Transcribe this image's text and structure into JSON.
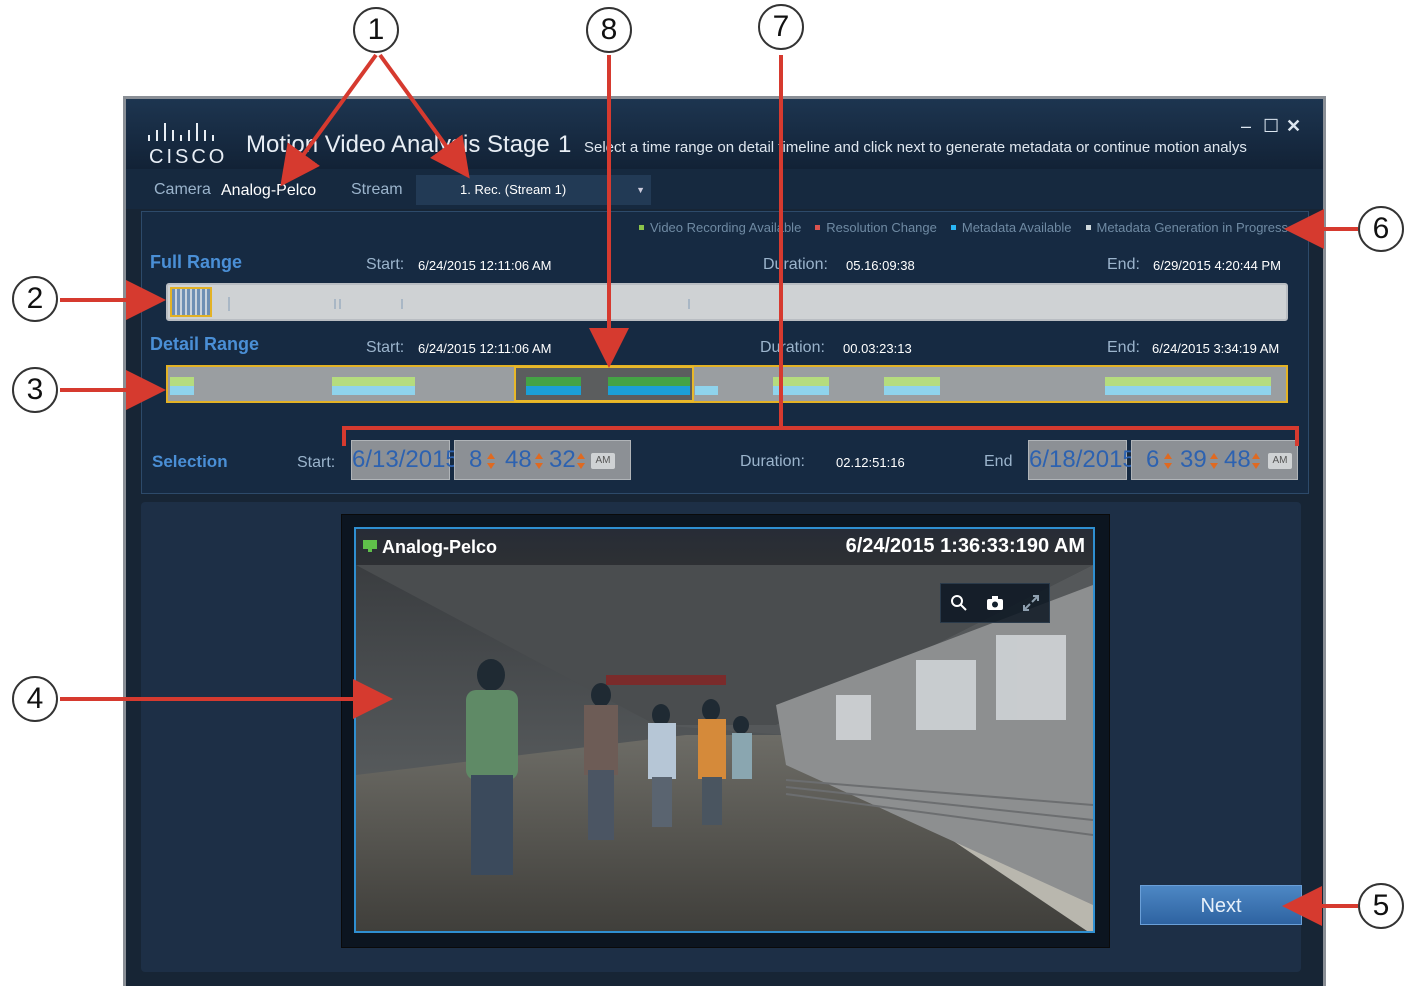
{
  "window": {
    "logo_text": "CISCO",
    "title": "Motion Video Analysis Stage",
    "stage": "1",
    "instructions": "Select a time range on detail timeline and click next to generate metadata or continue motion analys",
    "minimize": "‒",
    "maximize": "☐",
    "close": "✕"
  },
  "camera": {
    "label": "Camera",
    "value": "Analog-Pelco",
    "stream_label": "Stream",
    "stream_number": "1.",
    "stream_value": "Rec. (Stream 1)",
    "stream_caret": "▼"
  },
  "legend": [
    {
      "label": "Video Recording Available",
      "color": "#8bc34a"
    },
    {
      "label": "Resolution Change",
      "color": "#d9534f"
    },
    {
      "label": "Metadata Available",
      "color": "#29b6f6"
    },
    {
      "label": "Metadata Generation in Progress",
      "color": "#cfd8dc"
    }
  ],
  "full_range": {
    "title": "Full Range",
    "start_label": "Start:",
    "start": "6/24/2015 12:11:06 AM",
    "duration_label": "Duration:",
    "duration": "05.16:09:38",
    "end_label": "End:",
    "end": "6/29/2015 4:20:44 PM"
  },
  "detail_range": {
    "title": "Detail Range",
    "start_label": "Start:",
    "start": "6/24/2015 12:11:06 AM",
    "duration_label": "Duration:",
    "duration": "00.03:23:13",
    "end_label": "End:",
    "end": "6/24/2015 3:34:19 AM"
  },
  "selection": {
    "title": "Selection",
    "start_label": "Start:",
    "start_date": "6/13/2015",
    "start_h": "8",
    "start_m": "48",
    "start_s": "32",
    "start_ampm": "AM",
    "duration_label": "Duration:",
    "duration": "02.12:51:16",
    "end_label": "End",
    "end_date": "6/18/2015",
    "end_h": "6",
    "end_m": "39",
    "end_s": "48",
    "end_ampm": "AM"
  },
  "player": {
    "camera": "Analog-Pelco",
    "timestamp": "6/24/2015 1:36:33:190 AM",
    "tools": [
      "zoom-icon",
      "camera-icon",
      "expand-icon"
    ]
  },
  "next_label": "Next",
  "callouts": [
    "1",
    "8",
    "7",
    "6",
    "2",
    "3",
    "4",
    "5"
  ],
  "colors": {
    "accent_blue": "#4a8fd6",
    "callout_arrow": "#d63a2f",
    "selection_border": "#e3b225"
  }
}
